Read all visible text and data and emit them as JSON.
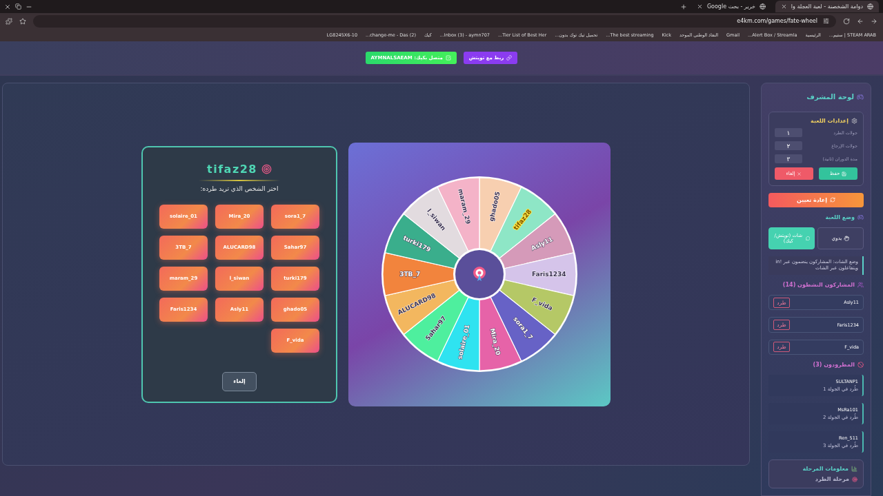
{
  "browser": {
    "tabs": [
      {
        "title": "دوامة الشخصنة - لعبة العجلة وا",
        "selected": true
      },
      {
        "title": "خرير - بحث Google",
        "selected": false
      }
    ],
    "url": "e4km.com/games/fate-wheel",
    "bookmarks": [
      "STEAM ARAB | ستيم...",
      "الرئيسية",
      "Alert Box / Streamla...",
      "Gmail",
      "النفاذ الوطني الموحد",
      "Kick",
      "The best streaming...",
      "تحميل تيك توك بدون...",
      "Tier List of Best Her...",
      "Inbox (3) - aymn707...",
      "كيك",
      "(2) change-me - Das...",
      "LG8245X6-10"
    ]
  },
  "top_actions": [
    {
      "label": "ربط مع تويتش",
      "kind": "twitch"
    },
    {
      "label": "متصل بكيك: AYMNALSAEAM",
      "kind": "kick"
    }
  ],
  "picker": {
    "title": "tifaz28",
    "prompt": "اختر الشخص الذي تريد طرده:",
    "choices": [
      "sora1_7",
      "Mira_20",
      "solaire_01",
      "Sahar97",
      "ALUCARD98",
      "3TB_7",
      "turki179",
      "l_siwan",
      "maram_29",
      "ghado05",
      "Asly11",
      "Faris1234",
      "F_vida"
    ],
    "cancel": "إلغاء"
  },
  "wheel": {
    "segments": [
      {
        "name": "ghado05",
        "color": "#f7cfb0",
        "selected": false
      },
      {
        "name": "tifaz28",
        "color": "#8ee6c6",
        "selected": true
      },
      {
        "name": "Asly11",
        "color": "#d59ab9",
        "selected": false
      },
      {
        "name": "Faris1234",
        "color": "#d5c4ea",
        "selected": false
      },
      {
        "name": "F_vida",
        "color": "#b5c866",
        "selected": false
      },
      {
        "name": "sora1_7",
        "color": "#6762c6",
        "selected": false
      },
      {
        "name": "Mira_20",
        "color": "#e663a8",
        "selected": false
      },
      {
        "name": "solaire_01",
        "color": "#2fe3f0",
        "selected": false
      },
      {
        "name": "Sahar97",
        "color": "#4eef9e",
        "selected": false
      },
      {
        "name": "ALUCARD98",
        "color": "#f3b75f",
        "selected": false
      },
      {
        "name": "3TB_7",
        "color": "#f2843d",
        "selected": false
      },
      {
        "name": "turki179",
        "color": "#3aae8c",
        "selected": false
      },
      {
        "name": "l_siwan",
        "color": "#e2dbdf",
        "selected": false
      },
      {
        "name": "maram_29",
        "color": "#f4b3c8",
        "selected": false
      }
    ]
  },
  "sidebar": {
    "title": "لوحة المشرف",
    "settings": {
      "title": "إعدادات اللعبة",
      "fields": [
        {
          "label": "جولات الطرد",
          "value": "١"
        },
        {
          "label": "جولات الإرجاع",
          "value": "٢"
        },
        {
          "label": "مدة الدوران (ثانية)",
          "value": "٣"
        }
      ],
      "save": "حفظ",
      "cancel": "إلغاء"
    },
    "reset": "إعادة تعيين",
    "mode": {
      "title": "وضع اللعبة",
      "options": [
        {
          "label": "يدوي",
          "selected": false
        },
        {
          "label": "شات (تويتش/كيك)",
          "selected": true
        }
      ],
      "note": "وضع الشات: المشاركون ينضمون عبر !in ويتفاعلون عبر الشات"
    },
    "active": {
      "title": "المشاركون النشطون (14)",
      "items": [
        {
          "name": "Asly11",
          "action": "طرد"
        },
        {
          "name": "Faris1234",
          "action": "طرد"
        },
        {
          "name": "F_vida",
          "action": "طرد"
        }
      ]
    },
    "kicked": {
      "title": "المطرودون (3)",
      "items": [
        {
          "name": "SULTANP1",
          "note": "طُرد في الجولة 1"
        },
        {
          "name": "MsRa101",
          "note": "طُرد في الجولة 2"
        },
        {
          "name": "Ren_511",
          "note": "طُرد في الجولة 3"
        }
      ]
    },
    "stage": {
      "title": "معلومات المرحلة",
      "phase": "مرحلة الطرد"
    }
  }
}
